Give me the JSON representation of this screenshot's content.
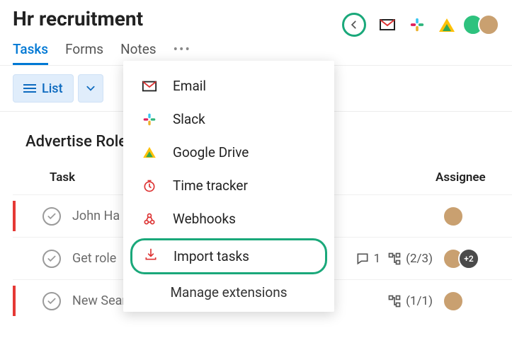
{
  "header": {
    "title": "Hr recruitment"
  },
  "tabs": {
    "items": [
      "Tasks",
      "Forms",
      "Notes"
    ],
    "more": "•••",
    "active": 0
  },
  "view_control": {
    "label": "List"
  },
  "section": {
    "title": "Advertise Role"
  },
  "columns": {
    "task": "Task",
    "assignee": "Assignee"
  },
  "rows": [
    {
      "name": "John Ha",
      "redbar": true
    },
    {
      "name": "Get role",
      "redbar": false,
      "comments": "1",
      "subtasks": "(2/3)",
      "extra_avatar": "+2"
    },
    {
      "name": "New Search",
      "redbar": true,
      "subtasks": "(1/1)"
    }
  ],
  "dropdown": {
    "items": [
      {
        "label": "Email",
        "icon": "envelope"
      },
      {
        "label": "Slack",
        "icon": "slack"
      },
      {
        "label": "Google Drive",
        "icon": "gdrive"
      },
      {
        "label": "Time tracker",
        "icon": "clock"
      },
      {
        "label": "Webhooks",
        "icon": "webhook"
      }
    ],
    "highlight": {
      "label": "Import tasks",
      "icon": "import"
    },
    "manage": "Manage extensions"
  }
}
